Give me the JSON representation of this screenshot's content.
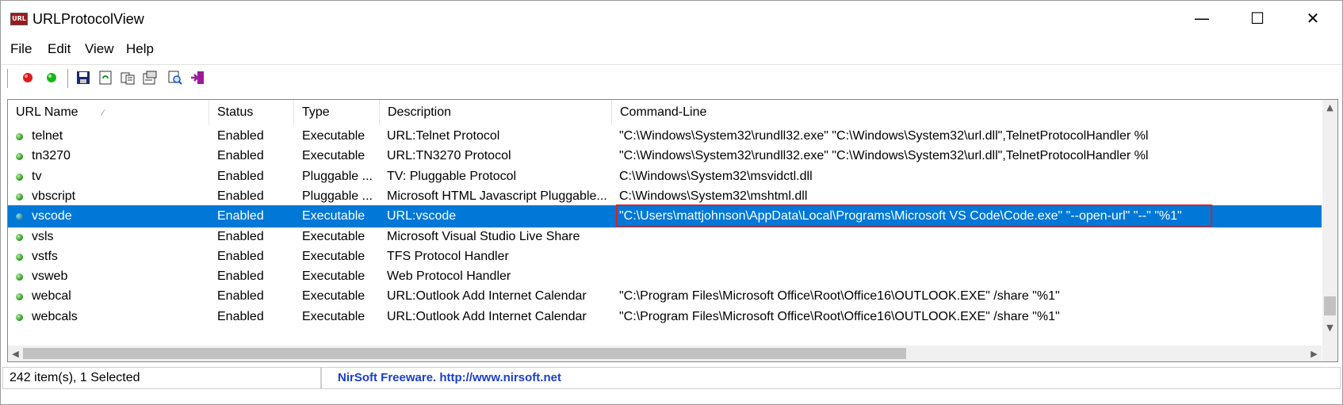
{
  "window": {
    "title": "URLProtocolView",
    "app_icon_text": "URL"
  },
  "title_buttons": {
    "minimize": "—",
    "maximize": "☐",
    "close": "✕"
  },
  "menu": [
    "File",
    "Edit",
    "View",
    "Help"
  ],
  "toolbar": [
    {
      "name": "enable-icon",
      "color": "#e01b1b"
    },
    {
      "name": "disable-icon",
      "color": "#1bb51b"
    },
    {
      "name": "save-icon"
    },
    {
      "name": "refresh-icon"
    },
    {
      "name": "copy-icon"
    },
    {
      "name": "properties-icon"
    },
    {
      "name": "find-icon"
    },
    {
      "name": "exit-icon"
    }
  ],
  "columns": [
    {
      "label": "URL Name",
      "sort": "⁄"
    },
    {
      "label": "Status"
    },
    {
      "label": "Type"
    },
    {
      "label": "Description"
    },
    {
      "label": "Command-Line"
    }
  ],
  "rows": [
    {
      "name": "telnet",
      "status": "Enabled",
      "type": "Executable",
      "description": "URL:Telnet Protocol",
      "command": "\"C:\\Windows\\System32\\rundll32.exe\" \"C:\\Windows\\System32\\url.dll\",TelnetProtocolHandler %l",
      "selected": false
    },
    {
      "name": "tn3270",
      "status": "Enabled",
      "type": "Executable",
      "description": "URL:TN3270 Protocol",
      "command": "\"C:\\Windows\\System32\\rundll32.exe\" \"C:\\Windows\\System32\\url.dll\",TelnetProtocolHandler %l",
      "selected": false
    },
    {
      "name": "tv",
      "status": "Enabled",
      "type": "Pluggable ...",
      "description": "TV: Pluggable Protocol",
      "command": "C:\\Windows\\System32\\msvidctl.dll",
      "selected": false
    },
    {
      "name": "vbscript",
      "status": "Enabled",
      "type": "Pluggable ...",
      "description": "Microsoft HTML Javascript Pluggable...",
      "command": "C:\\Windows\\System32\\mshtml.dll",
      "selected": false
    },
    {
      "name": "vscode",
      "status": "Enabled",
      "type": "Executable",
      "description": "URL:vscode",
      "command": "\"C:\\Users\\mattjohnson\\AppData\\Local\\Programs\\Microsoft VS Code\\Code.exe\" \"--open-url\"  \"--\" \"%1\"",
      "selected": true
    },
    {
      "name": "vsls",
      "status": "Enabled",
      "type": "Executable",
      "description": "Microsoft Visual Studio Live Share",
      "command": "",
      "selected": false
    },
    {
      "name": "vstfs",
      "status": "Enabled",
      "type": "Executable",
      "description": "TFS Protocol Handler",
      "command": "",
      "selected": false
    },
    {
      "name": "vsweb",
      "status": "Enabled",
      "type": "Executable",
      "description": "Web Protocol Handler",
      "command": "",
      "selected": false
    },
    {
      "name": "webcal",
      "status": "Enabled",
      "type": "Executable",
      "description": "URL:Outlook Add Internet Calendar",
      "command": "\"C:\\Program Files\\Microsoft Office\\Root\\Office16\\OUTLOOK.EXE\" /share \"%1\"",
      "selected": false
    },
    {
      "name": "webcals",
      "status": "Enabled",
      "type": "Executable",
      "description": "URL:Outlook Add Internet Calendar",
      "command": "\"C:\\Program Files\\Microsoft Office\\Root\\Office16\\OUTLOOK.EXE\" /share \"%1\"",
      "selected": false
    }
  ],
  "scrollbars": {
    "up": "▲",
    "down": "▼",
    "left": "◀",
    "right": "▶"
  },
  "status": {
    "count": "242 item(s), 1 Selected",
    "credit": "NirSoft Freeware.  http://www.nirsoft.net"
  },
  "colors": {
    "selection": "#0078d7",
    "highlight_border": "#e02020",
    "credit_text": "#1a3fd0"
  }
}
